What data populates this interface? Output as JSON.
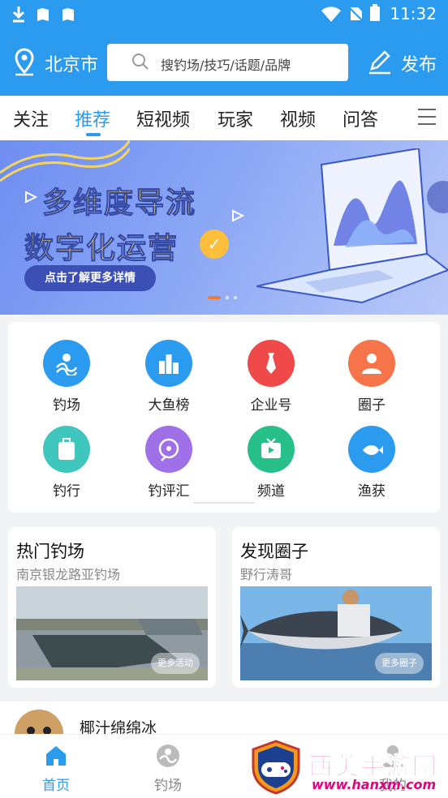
{
  "status_bar": {
    "left_icons": [
      "download-icon",
      "app-icon",
      "app-icon"
    ],
    "time": "11:32",
    "right_icons": [
      "wifi-icon",
      "no-sim-icon",
      "battery-icon"
    ]
  },
  "header": {
    "city": "北京市",
    "search_placeholder": "搜钓场/技巧/话题/品牌",
    "publish_label": "发布",
    "bg_color": "#2a9bee"
  },
  "tabs": {
    "items": [
      "关注",
      "推荐",
      "短视频",
      "玩家",
      "视频",
      "问答"
    ],
    "active_index": 1
  },
  "banner": {
    "line1": "多维度导流",
    "line2": "数字化运营",
    "cta": "点击了解更多详情",
    "page_count": 3,
    "active_page": 0
  },
  "grid": {
    "items": [
      {
        "label": "钓场",
        "icon": "fishing-spot-icon",
        "color": "#2a9bee"
      },
      {
        "label": "大鱼榜",
        "icon": "leaderboard-icon",
        "color": "#2a9bee"
      },
      {
        "label": "企业号",
        "icon": "tie-icon",
        "color": "#f0494a"
      },
      {
        "label": "圈子",
        "icon": "group-icon",
        "color": "#f5744a"
      },
      {
        "label": "钓行",
        "icon": "travel-icon",
        "color": "#3fc6bd"
      },
      {
        "label": "钓评汇",
        "icon": "review-icon",
        "color": "#a070e8"
      },
      {
        "label": "频道",
        "icon": "channel-icon",
        "color": "#28c08a"
      },
      {
        "label": "渔获",
        "icon": "catch-icon",
        "color": "#2a9bee"
      }
    ]
  },
  "cards": [
    {
      "title": "热门钓场",
      "subtitle": "南京银龙路亚钓场",
      "more": "更多活动"
    },
    {
      "title": "发现圈子",
      "subtitle": "野行涛哥",
      "more": "更多圈子"
    }
  ],
  "post": {
    "author": "椰汁绵绵冰"
  },
  "bottom_nav": {
    "items": [
      "首页",
      "钓场",
      "我的"
    ],
    "active_index": 0,
    "active_color": "#2a9bee"
  },
  "watermark": {
    "brand": "西美手游网",
    "url": "www.hanxm.com"
  }
}
